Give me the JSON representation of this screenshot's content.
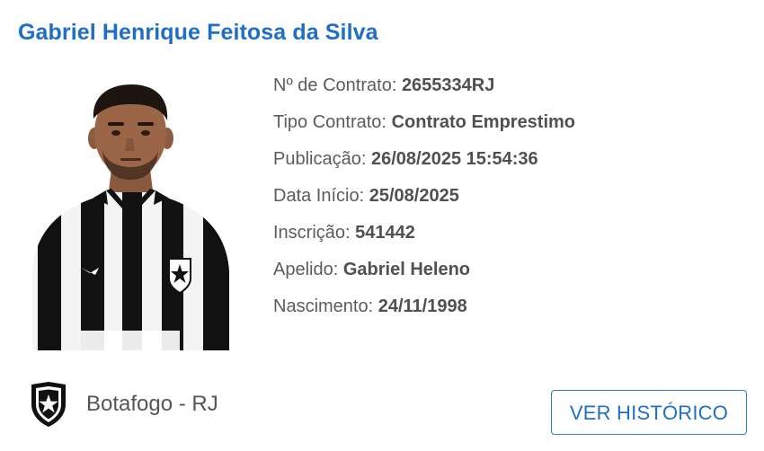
{
  "player": {
    "name": "Gabriel Henrique Feitosa da Silva"
  },
  "details": [
    {
      "label": "Nº de Contrato:",
      "value": "2655334RJ"
    },
    {
      "label": "Tipo Contrato:",
      "value": "Contrato Emprestimo"
    },
    {
      "label": "Publicação:",
      "value": "26/08/2025 15:54:36"
    },
    {
      "label": "Data Início:",
      "value": "25/08/2025"
    },
    {
      "label": "Inscrição:",
      "value": "541442"
    },
    {
      "label": "Apelido:",
      "value": "Gabriel Heleno"
    },
    {
      "label": "Nascimento:",
      "value": "24/11/1998"
    }
  ],
  "club": {
    "name": "Botafogo - RJ",
    "crest_icon": "botafogo-star-crest-icon"
  },
  "actions": {
    "history_label": "VER HISTÓRICO"
  },
  "colors": {
    "accent": "#1f6fc5",
    "label_text": "#5c5c5c",
    "value_text": "#505050",
    "button_border": "#2f7bd0"
  }
}
